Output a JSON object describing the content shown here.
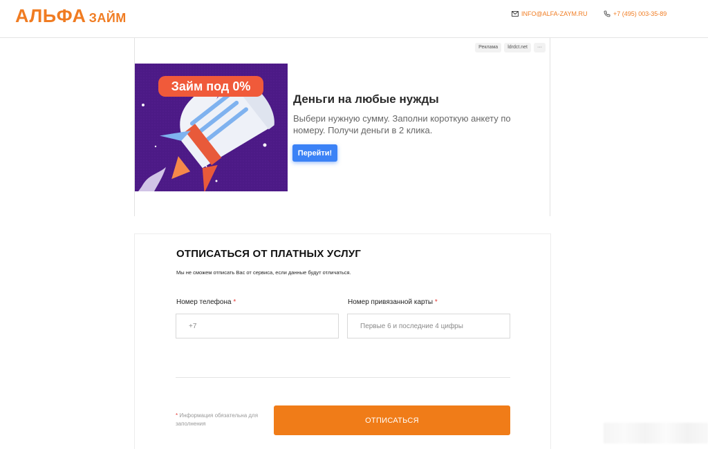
{
  "header": {
    "logo_main": "АЛЬФА",
    "logo_sub": "ЗАЙМ",
    "email": "INFO@ALFA-ZAYM.RU",
    "phone": "+7 (495) 003-35-89"
  },
  "ad": {
    "tag_ad": "Реклама",
    "tag_domain": "ldrdct.net",
    "tag_more": "···",
    "image_badge": "Займ под 0%",
    "title": "Деньги на любые нужды",
    "description": "Выбери нужную сумму. Заполни короткую анкету по номеру. Получи деньги в 2 клика.",
    "button": "Перейти!"
  },
  "form": {
    "title": "ОТПИСАТЬСЯ ОТ ПЛАТНЫХ УСЛУГ",
    "note": "Мы не сможем отписать Вас от сервиса, если данные будут отличаться.",
    "phone_label": "Номер телефона",
    "phone_placeholder": "+7",
    "card_label": "Номер привязанной карты",
    "card_placeholder": "Первые 6 и последние 4 цифры",
    "required_mark": "*",
    "required_note": "Информация обязательна для заполнения",
    "submit": "ОТПИСАТЬСЯ"
  },
  "colors": {
    "brand": "#f07c22",
    "ad_button": "#3b82f6",
    "required": "#e53935"
  }
}
